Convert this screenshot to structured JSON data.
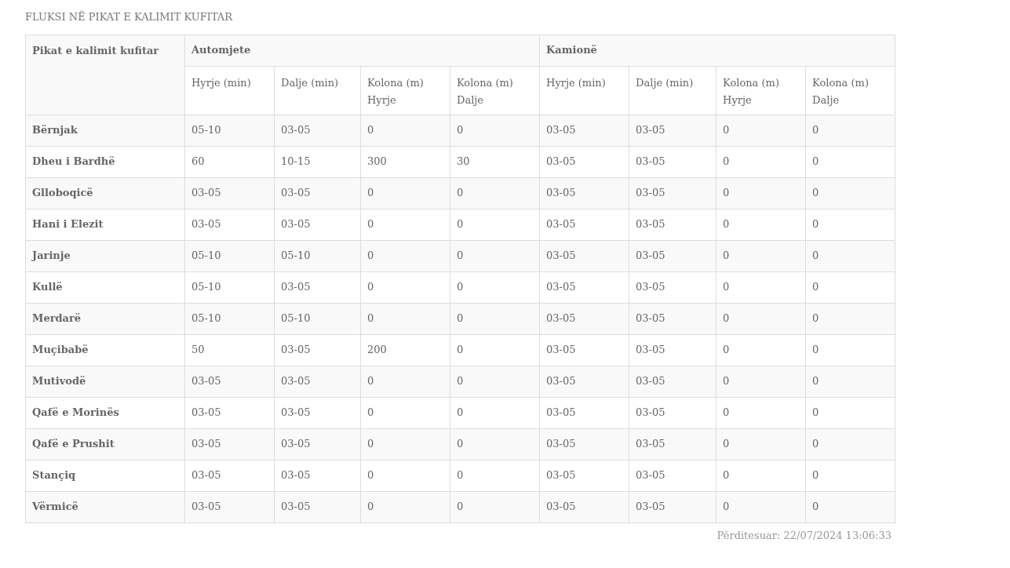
{
  "title": "FLUKSI NË PIKAT E KALIMIT KUFITAR",
  "table": {
    "first_column": "Pikat e kalimit kufitar",
    "groups": [
      {
        "label": "Automjete",
        "columns": [
          "Hyrje (min)",
          "Dalje (min)",
          "Kolona (m) Hyrje",
          "Kolona (m) Dalje"
        ]
      },
      {
        "label": "Kamionë",
        "columns": [
          "Hyrje (min)",
          "Dalje (min)",
          "Kolona (m) Hyrje",
          "Kolona (m) Dalje"
        ]
      }
    ],
    "rows": [
      {
        "name": "Bërnjak",
        "cells": [
          "05-10",
          "03-05",
          "0",
          "0",
          "03-05",
          "03-05",
          "0",
          "0"
        ]
      },
      {
        "name": "Dheu i Bardhë",
        "cells": [
          "60",
          "10-15",
          "300",
          "30",
          "03-05",
          "03-05",
          "0",
          "0"
        ]
      },
      {
        "name": "Glloboqicë",
        "cells": [
          "03-05",
          "03-05",
          "0",
          "0",
          "03-05",
          "03-05",
          "0",
          "0"
        ]
      },
      {
        "name": "Hani i Elezit",
        "cells": [
          "03-05",
          "03-05",
          "0",
          "0",
          "03-05",
          "03-05",
          "0",
          "0"
        ]
      },
      {
        "name": "Jarinje",
        "cells": [
          "05-10",
          "05-10",
          "0",
          "0",
          "03-05",
          "03-05",
          "0",
          "0"
        ]
      },
      {
        "name": "Kullë",
        "cells": [
          "05-10",
          "03-05",
          "0",
          "0",
          "03-05",
          "03-05",
          "0",
          "0"
        ]
      },
      {
        "name": "Merdarë",
        "cells": [
          "05-10",
          "05-10",
          "0",
          "0",
          "03-05",
          "03-05",
          "0",
          "0"
        ]
      },
      {
        "name": "Muçibabë",
        "cells": [
          "50",
          "03-05",
          "200",
          "0",
          "03-05",
          "03-05",
          "0",
          "0"
        ]
      },
      {
        "name": "Mutivodë",
        "cells": [
          "03-05",
          "03-05",
          "0",
          "0",
          "03-05",
          "03-05",
          "0",
          "0"
        ]
      },
      {
        "name": "Qafë e Morinës",
        "cells": [
          "03-05",
          "03-05",
          "0",
          "0",
          "03-05",
          "03-05",
          "0",
          "0"
        ]
      },
      {
        "name": "Qafë e Prushit",
        "cells": [
          "03-05",
          "03-05",
          "0",
          "0",
          "03-05",
          "03-05",
          "0",
          "0"
        ]
      },
      {
        "name": "Stançiq",
        "cells": [
          "03-05",
          "03-05",
          "0",
          "0",
          "03-05",
          "03-05",
          "0",
          "0"
        ]
      },
      {
        "name": "Vërmicë",
        "cells": [
          "03-05",
          "03-05",
          "0",
          "0",
          "03-05",
          "03-05",
          "0",
          "0"
        ]
      }
    ]
  },
  "updated": "Përditesuar: 22/07/2024 13:06:33"
}
